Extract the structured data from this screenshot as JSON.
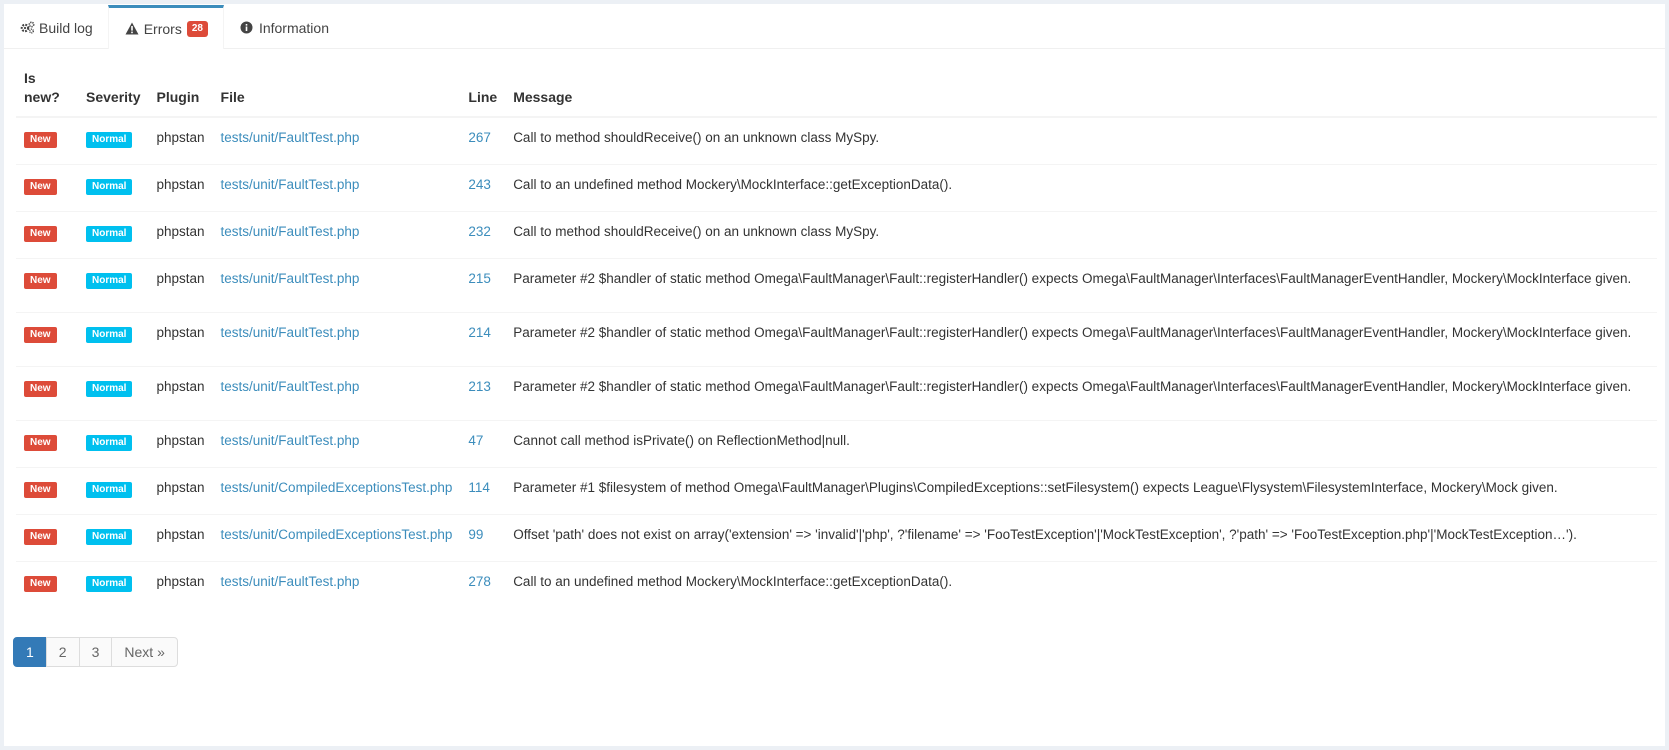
{
  "tabs": [
    {
      "label": "Build log",
      "icon": "gears-icon"
    },
    {
      "label": "Errors",
      "icon": "warning-icon",
      "badge": "28"
    },
    {
      "label": "Information",
      "icon": "info-icon"
    }
  ],
  "table": {
    "headers": {
      "is_new": "Is new?",
      "severity": "Severity",
      "plugin": "Plugin",
      "file": "File",
      "line": "Line",
      "message": "Message"
    },
    "rows": [
      {
        "is_new": "New",
        "severity": "Normal",
        "plugin": "phpstan",
        "file": "tests/unit/FaultTest.php",
        "line": "267",
        "message": "Call to method shouldReceive() on an unknown class MySpy."
      },
      {
        "is_new": "New",
        "severity": "Normal",
        "plugin": "phpstan",
        "file": "tests/unit/FaultTest.php",
        "line": "243",
        "message": "Call to an undefined method Mockery\\MockInterface::getExceptionData()."
      },
      {
        "is_new": "New",
        "severity": "Normal",
        "plugin": "phpstan",
        "file": "tests/unit/FaultTest.php",
        "line": "232",
        "message": "Call to method shouldReceive() on an unknown class MySpy."
      },
      {
        "is_new": "New",
        "severity": "Normal",
        "plugin": "phpstan",
        "file": "tests/unit/FaultTest.php",
        "line": "215",
        "message": "Parameter #2 $handler of static method Omega\\FaultManager\\Fault::registerHandler() expects Omega\\FaultManager\\Interfaces\\FaultManagerEventHandler, Mockery\\MockInterface given."
      },
      {
        "is_new": "New",
        "severity": "Normal",
        "plugin": "phpstan",
        "file": "tests/unit/FaultTest.php",
        "line": "214",
        "message": "Parameter #2 $handler of static method Omega\\FaultManager\\Fault::registerHandler() expects Omega\\FaultManager\\Interfaces\\FaultManagerEventHandler, Mockery\\MockInterface given."
      },
      {
        "is_new": "New",
        "severity": "Normal",
        "plugin": "phpstan",
        "file": "tests/unit/FaultTest.php",
        "line": "213",
        "message": "Parameter #2 $handler of static method Omega\\FaultManager\\Fault::registerHandler() expects Omega\\FaultManager\\Interfaces\\FaultManagerEventHandler, Mockery\\MockInterface given."
      },
      {
        "is_new": "New",
        "severity": "Normal",
        "plugin": "phpstan",
        "file": "tests/unit/FaultTest.php",
        "line": "47",
        "message": "Cannot call method isPrivate() on ReflectionMethod|null."
      },
      {
        "is_new": "New",
        "severity": "Normal",
        "plugin": "phpstan",
        "file": "tests/unit/CompiledExceptionsTest.php",
        "line": "114",
        "message": "Parameter #1 $filesystem of method Omega\\FaultManager\\Plugins\\CompiledExceptions::setFilesystem() expects League\\Flysystem\\FilesystemInterface, Mockery\\Mock given."
      },
      {
        "is_new": "New",
        "severity": "Normal",
        "plugin": "phpstan",
        "file": "tests/unit/CompiledExceptionsTest.php",
        "line": "99",
        "message": "Offset 'path' does not exist on array('extension' => 'invalid'|'php', ?'filename' => 'FooTestException'|'MockTestException', ?'path' => 'FooTestException.php'|'MockTestException…')."
      },
      {
        "is_new": "New",
        "severity": "Normal",
        "plugin": "phpstan",
        "file": "tests/unit/FaultTest.php",
        "line": "278",
        "message": "Call to an undefined method Mockery\\MockInterface::getExceptionData()."
      }
    ]
  },
  "pagination": {
    "pages": [
      "1",
      "2",
      "3"
    ],
    "next": "Next »"
  }
}
